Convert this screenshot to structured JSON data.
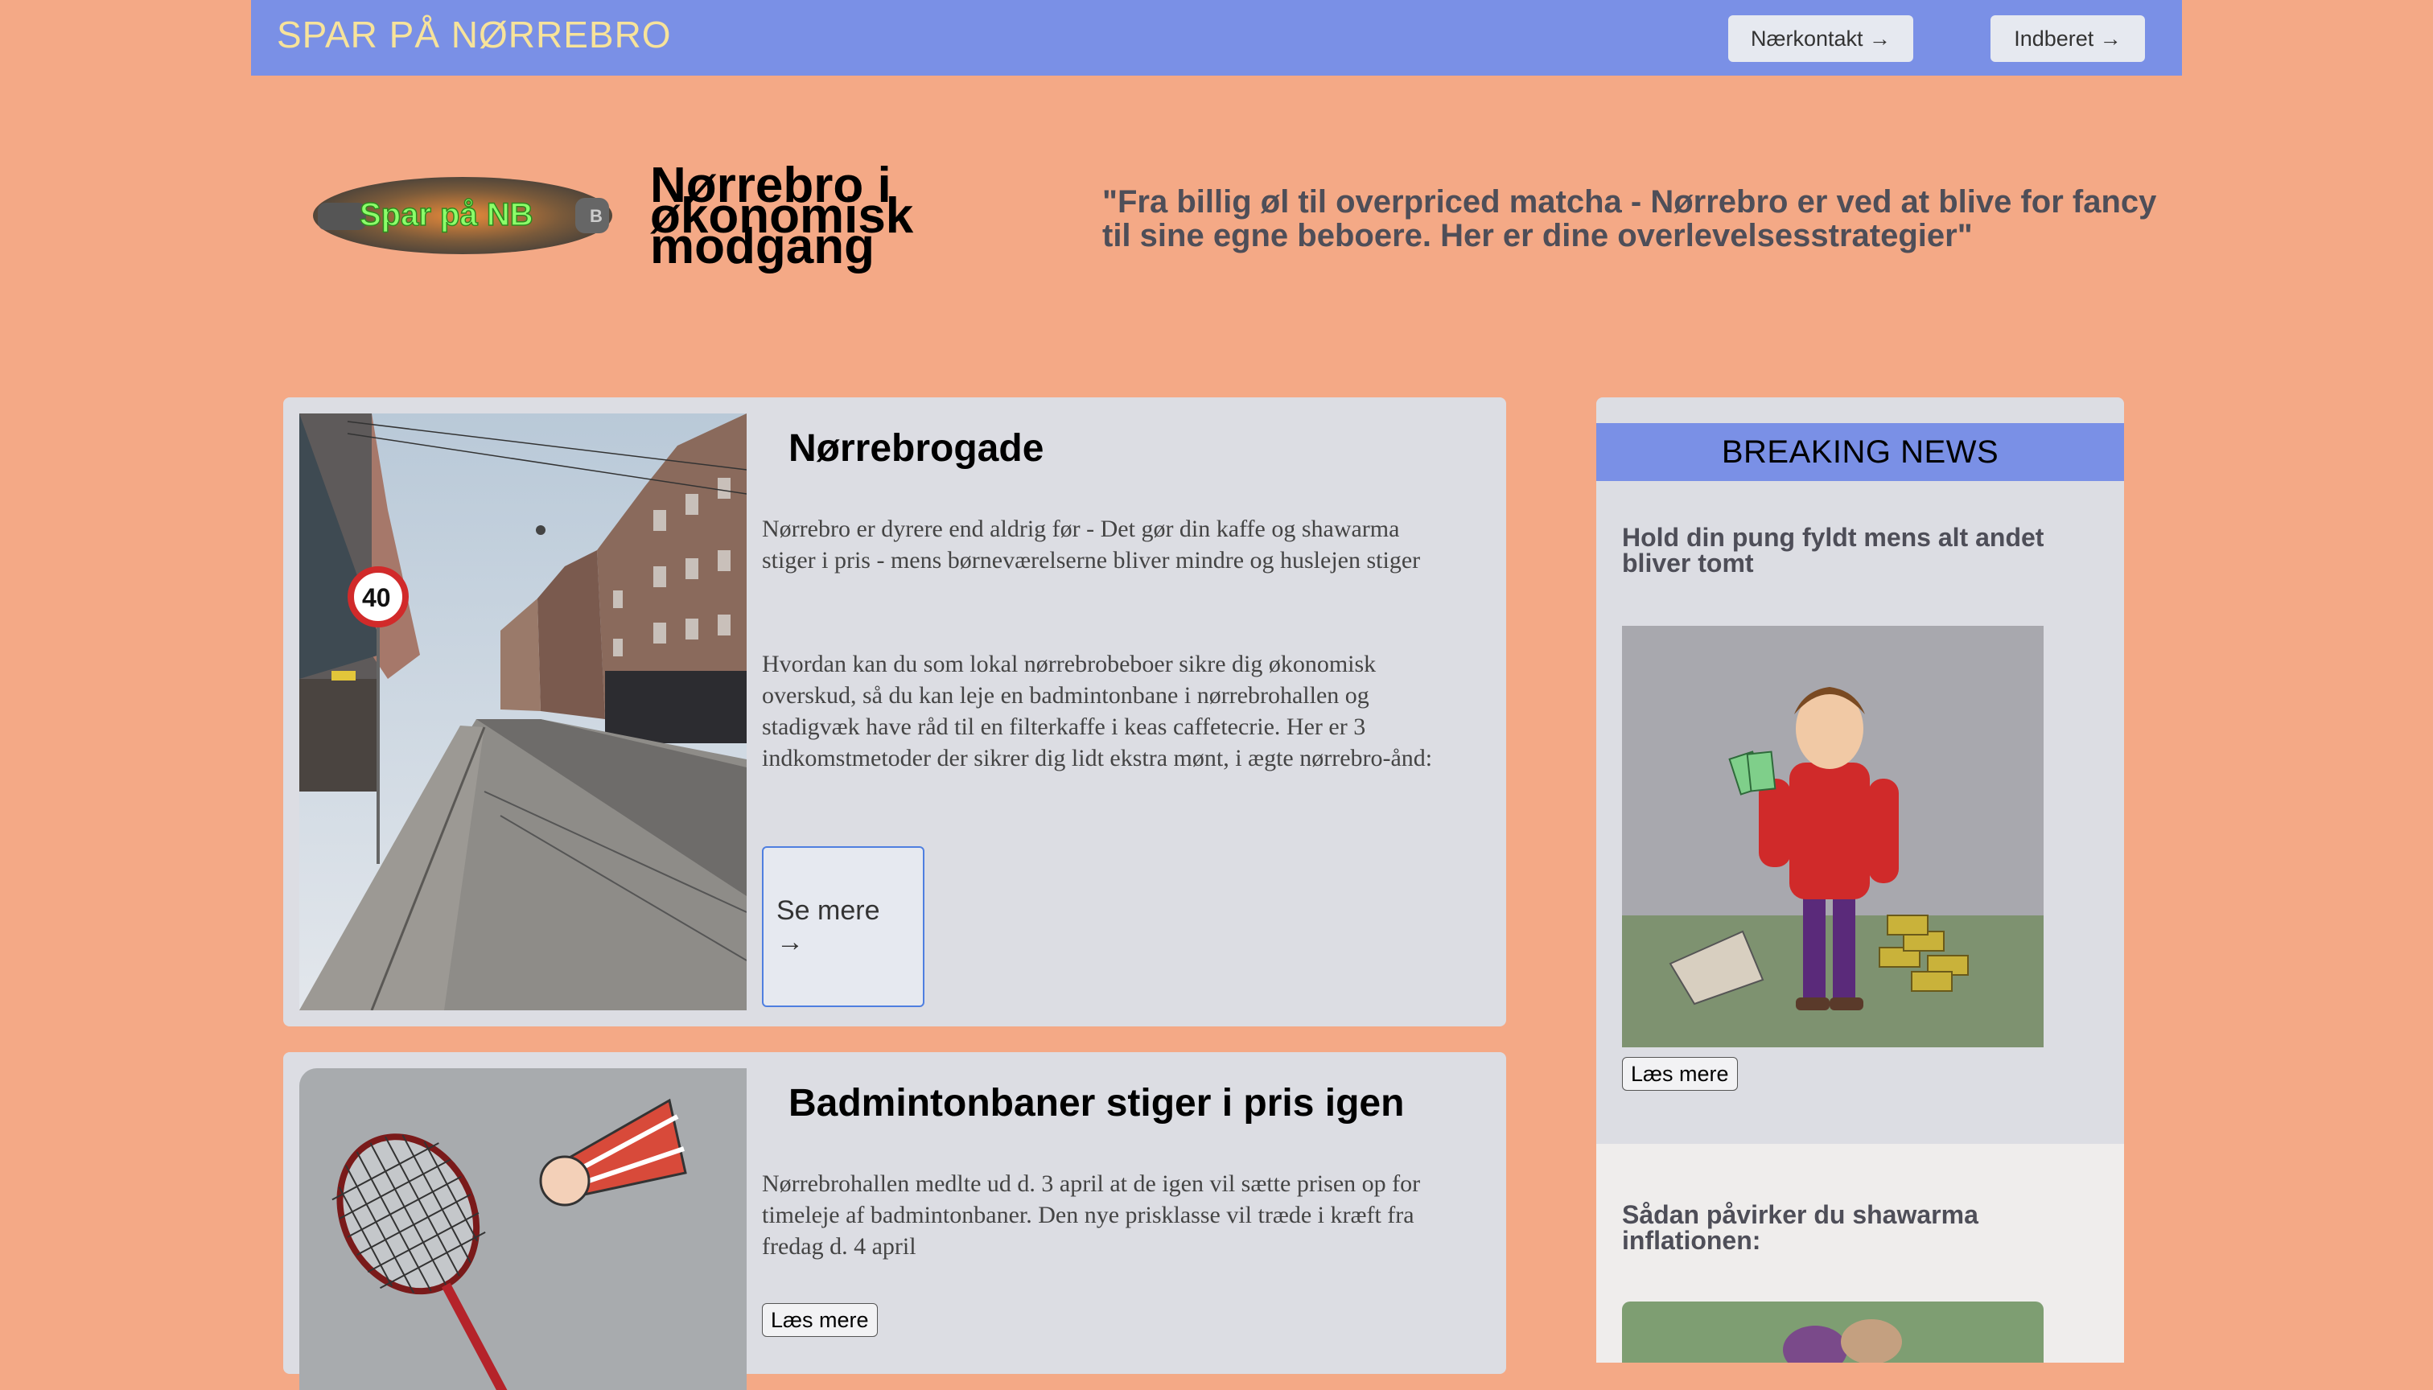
{
  "nav": {
    "brand": "SPAR PÅ NØRREBRO",
    "buttons": [
      "Nærkontakt →",
      "Indberet →"
    ]
  },
  "hero": {
    "logo_text": "Spar på NB",
    "title": "Nørrebro i økonomisk modgang",
    "quote": "\"Fra billig øl til overpriced matcha - Nørrebro er ved at blive for fancy til sine egne beboere. Her er dine overlevelsesstrategier\""
  },
  "articles": [
    {
      "title": "Nørrebrogade",
      "paragraphs": [
        "Nørrebro er dyrere end aldrig før - Det gør din kaffe og shawarma stiger i pris - mens børneværelserne bliver mindre og huslejen stiger",
        "Hvordan kan du som lokal nørrebrobeboer sikre dig økonomisk overskud, så du kan leje en badmintonbane i nørrebrohallen og stadigvæk have råd til en filterkaffe i keas caffetecrie. Her er 3 indkomstmetoder der sikrer dig lidt ekstra mønt, i ægte nørrebro-ånd:"
      ],
      "button": "Se mere  →",
      "image": {
        "icon": "street-photo",
        "sign": "40"
      }
    },
    {
      "title": "Badmintonbaner stiger i pris igen",
      "paragraphs": [
        "Nørrebrohallen medlte ud d. 3 april at de igen vil sætte prisen op for timeleje af badmintonbaner. Den nye prisklasse vil træde i kræft fra fredag d. 4 april"
      ],
      "button": "Læs mere",
      "image": {
        "icon": "badminton-illustration"
      }
    }
  ],
  "sidebar": {
    "heading": "BREAKING NEWS",
    "items": [
      {
        "headline": "Hold din pung fyldt mens alt andet bliver tomt",
        "button": "Læs mere",
        "image": {
          "icon": "man-with-money-illustration"
        }
      },
      {
        "headline": "Sådan påvirker du shawarma inflationen:",
        "image": {
          "icon": "shawarma-illustration"
        }
      }
    ]
  },
  "colors": {
    "page_bg": "#F4A986",
    "nav_bg": "#7A90E6",
    "brand": "#F7E39A",
    "card_bg": "#DCDDE3",
    "accent_border": "#4F7FE0"
  }
}
